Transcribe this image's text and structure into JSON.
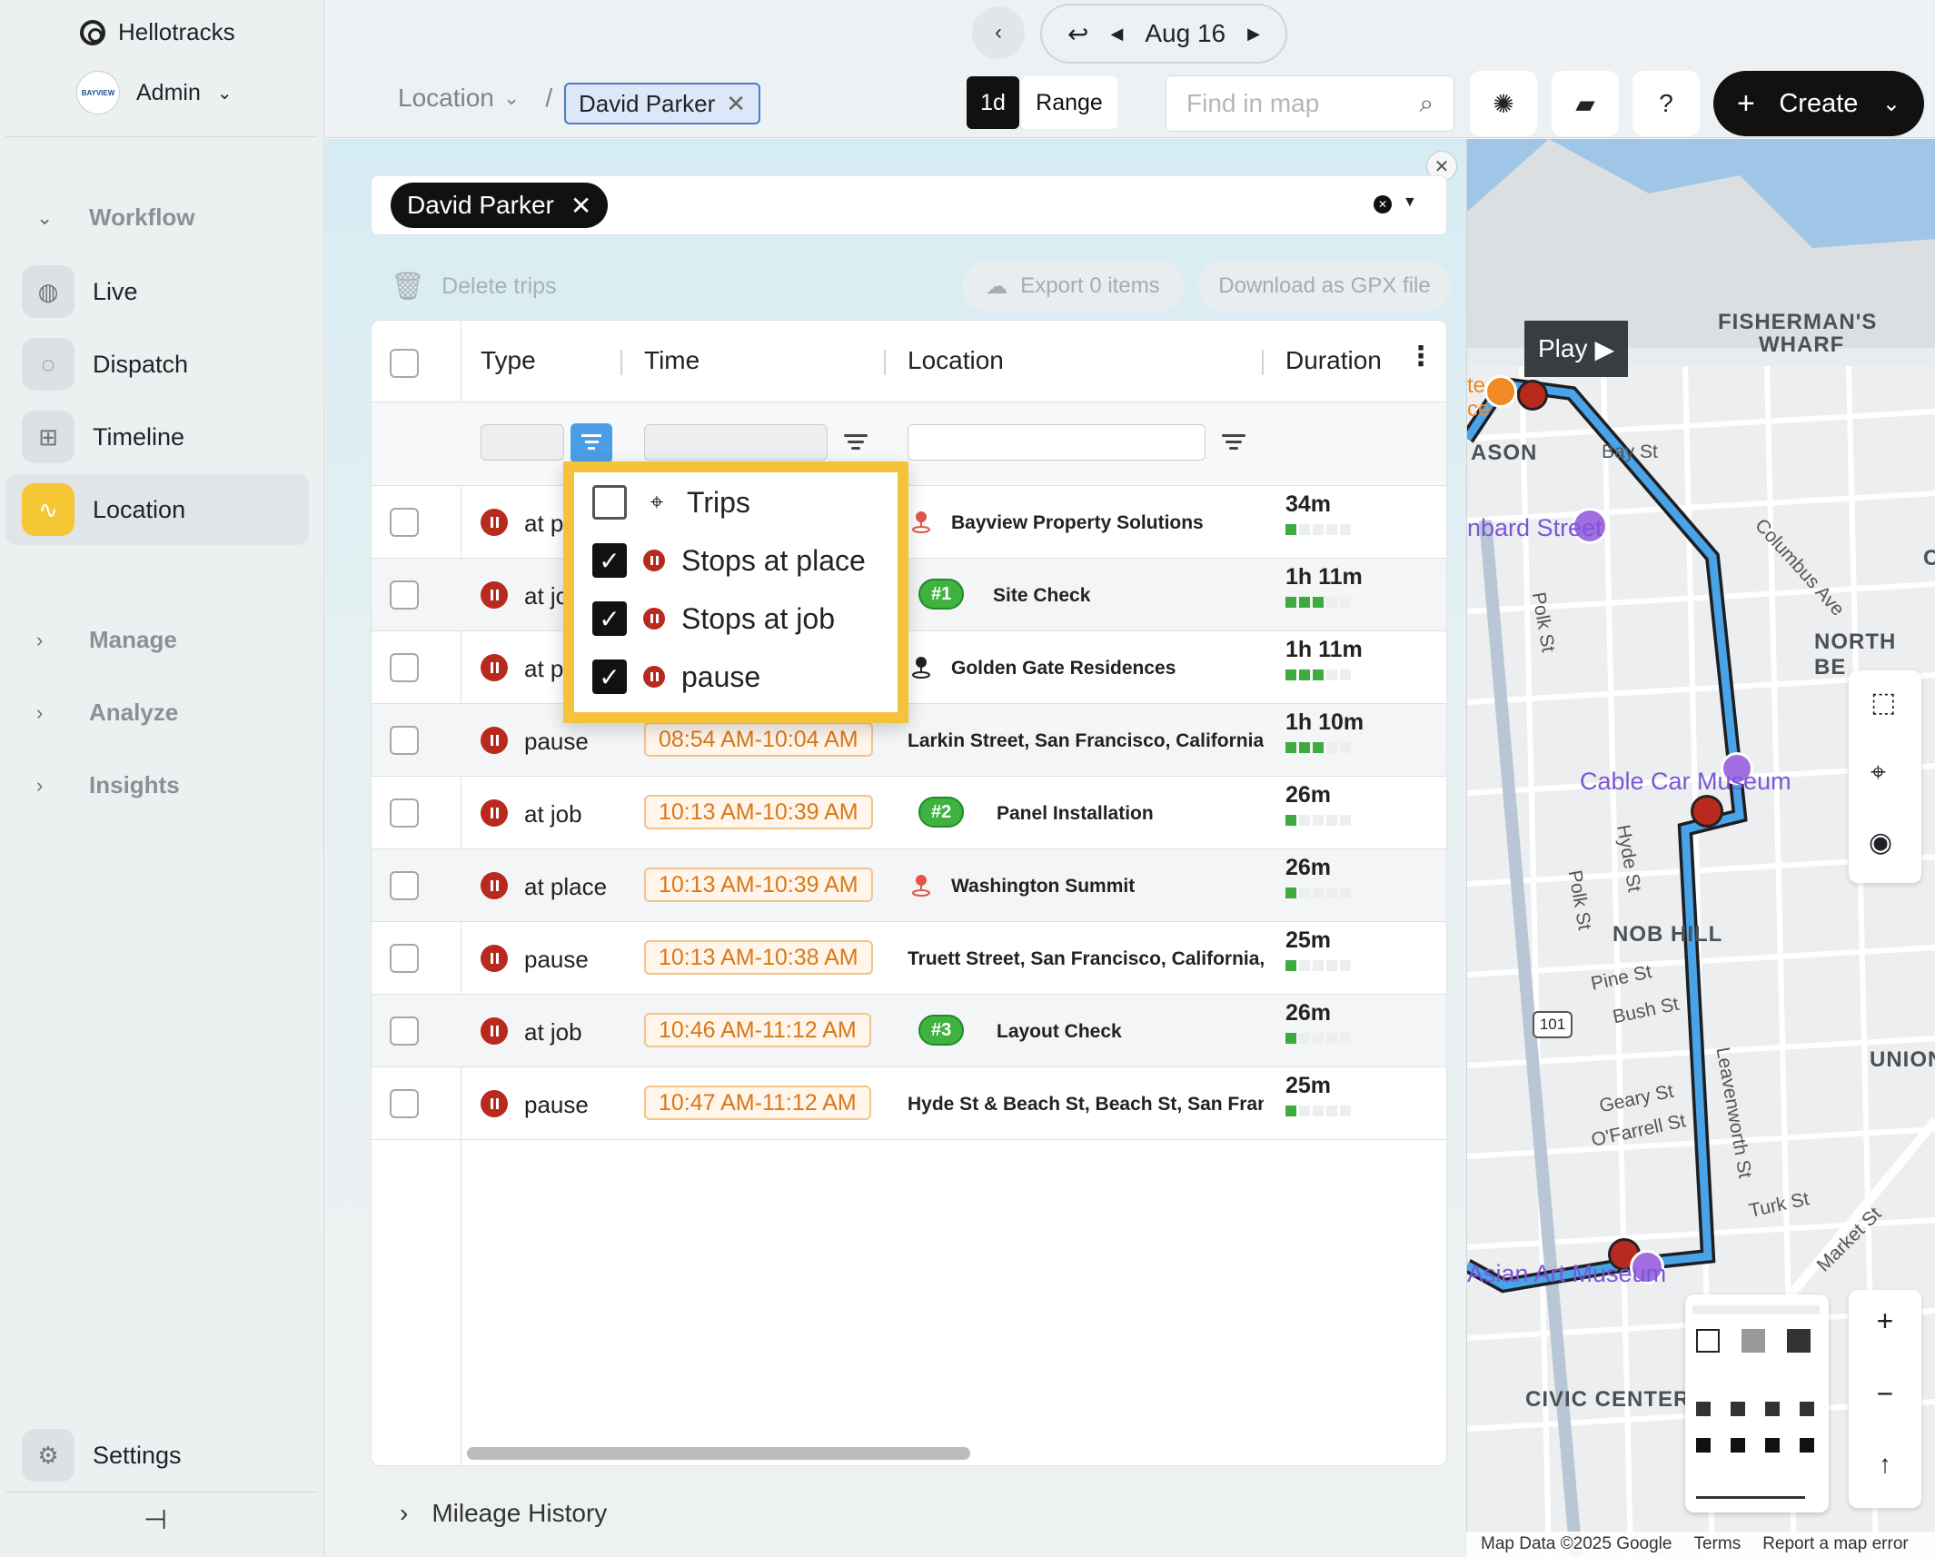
{
  "sidebar": {
    "brand": "Hellotracks",
    "account": {
      "avatar_text": "BAYVIEW",
      "name": "Admin"
    },
    "groups": {
      "workflow": "Workflow",
      "manage": "Manage",
      "analyze": "Analyze",
      "insights": "Insights"
    },
    "items": [
      {
        "label": "Live",
        "icon": "globe-icon"
      },
      {
        "label": "Dispatch",
        "icon": "dispatch-icon"
      },
      {
        "label": "Timeline",
        "icon": "timeline-icon"
      },
      {
        "label": "Location",
        "icon": "route-icon",
        "active": true
      }
    ],
    "settings": "Settings"
  },
  "topbar": {
    "date": "Aug 16",
    "breadcrumb_root": "Location",
    "breadcrumb_sep": "/",
    "breadcrumb_chip": "David Parker",
    "seg_1d": "1d",
    "seg_range": "Range",
    "search_placeholder": "Find in map",
    "help": "?",
    "create": "Create"
  },
  "panel": {
    "person_chip": "David Parker",
    "delete_trips": "Delete trips",
    "export": "Export 0 items",
    "download": "Download as GPX file",
    "mileage": "Mileage History"
  },
  "table": {
    "headers": {
      "type": "Type",
      "time": "Time",
      "location": "Location",
      "duration": "Duration"
    },
    "rows": [
      {
        "type": "at p",
        "time": "",
        "location": "Bayview Property Solutions",
        "job": "",
        "pin": "red",
        "duration": "34m",
        "bars": 1
      },
      {
        "type": "at jo",
        "time": "",
        "location": "Site Check",
        "job": "#1",
        "pin": "",
        "duration": "1h 11m",
        "bars": 3
      },
      {
        "type": "at p",
        "time": "",
        "location": "Golden Gate Residences",
        "job": "",
        "pin": "black",
        "duration": "1h 11m",
        "bars": 3
      },
      {
        "type": "pause",
        "time": "08:54 AM-10:04 AM",
        "location": "Larkin Street, San Francisco, California,",
        "job": "",
        "pin": "",
        "duration": "1h 10m",
        "bars": 3
      },
      {
        "type": "at job",
        "time": "10:13 AM-10:39 AM",
        "location": "Panel Installation",
        "job": "#2",
        "pin": "",
        "duration": "26m",
        "bars": 1
      },
      {
        "type": "at place",
        "time": "10:13 AM-10:39 AM",
        "location": "Washington Summit",
        "job": "",
        "pin": "red",
        "duration": "26m",
        "bars": 1
      },
      {
        "type": "pause",
        "time": "10:13 AM-10:38 AM",
        "location": "Truett Street, San Francisco, California,",
        "job": "",
        "pin": "",
        "duration": "25m",
        "bars": 1
      },
      {
        "type": "at job",
        "time": "10:46 AM-11:12 AM",
        "location": "Layout Check",
        "job": "#3",
        "pin": "",
        "duration": "26m",
        "bars": 1
      },
      {
        "type": "pause",
        "time": "10:47 AM-11:12 AM",
        "location": "Hyde St & Beach St, Beach St, San Franc",
        "job": "",
        "pin": "",
        "duration": "25m",
        "bars": 1
      }
    ]
  },
  "type_filter": {
    "options": [
      {
        "label": "Trips",
        "checked": false,
        "icon": "route-pin-icon"
      },
      {
        "label": "Stops at place",
        "checked": true,
        "icon": "stop-icon"
      },
      {
        "label": "Stops at job",
        "checked": true,
        "icon": "stop-icon"
      },
      {
        "label": "pause",
        "checked": true,
        "icon": "stop-icon"
      }
    ]
  },
  "map": {
    "play": "Play",
    "labels": {
      "fishermans": "FISHERMAN'S",
      "wharf": "WHARF",
      "mason": "ASON",
      "bay_st": "Bay St",
      "lombard": "nbard Street",
      "columbus": "Columbus Ave",
      "north_beach": "NORTH BE",
      "polk1": "Polk St",
      "cable_car": "Cable Car Museum",
      "hyde": "Hyde St",
      "polk2": "Polk St",
      "nob_hill": "NOB HILL",
      "pine": "Pine St",
      "bush": "Bush St",
      "hwy": "101",
      "leavenworth": "Leavenworth St",
      "union": "UNION",
      "geary": "Geary St",
      "ofarrell": "O'Farrell St",
      "turk": "Turk St",
      "market": "Market St",
      "asian_art": "Asian Art Museum",
      "civic": "CIVIC CENTER",
      "c_edge": "C",
      "te": "te",
      "ce": "ce"
    },
    "footer": {
      "data": "Map Data ©2025 Google",
      "terms": "Terms",
      "report": "Report a map error"
    },
    "zoom_in": "+",
    "zoom_out": "−"
  }
}
